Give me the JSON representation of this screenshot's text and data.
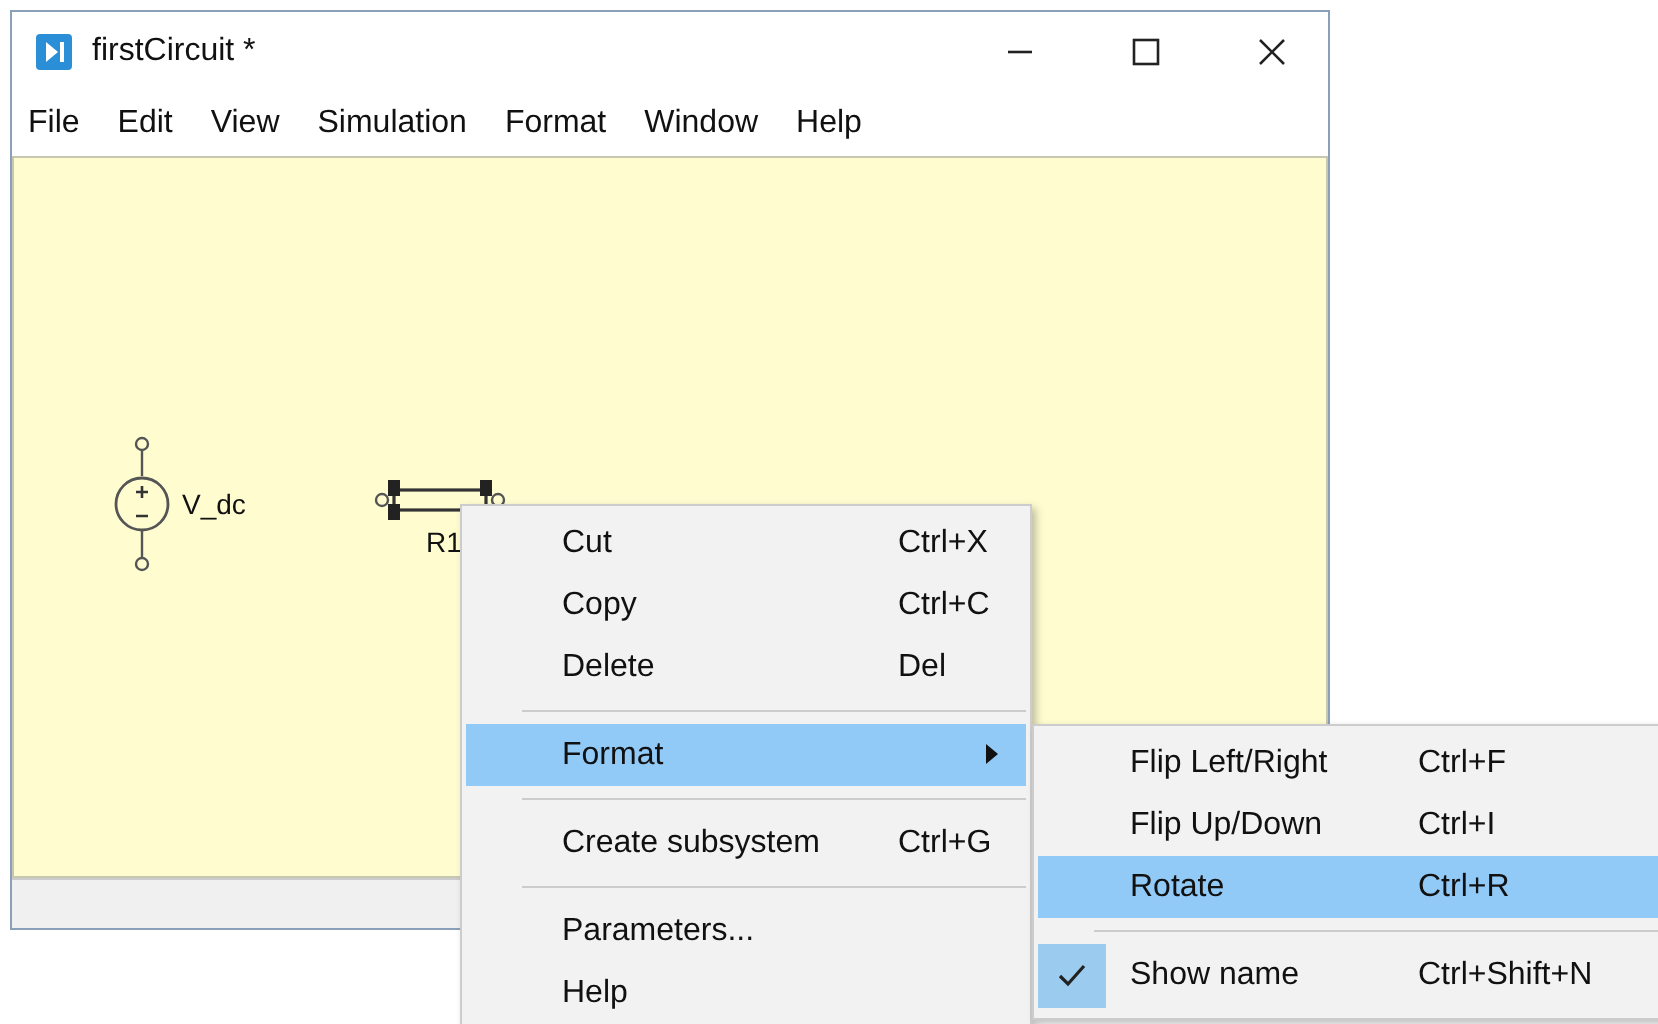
{
  "window": {
    "title": "firstCircuit *"
  },
  "menu_bar": [
    "File",
    "Edit",
    "View",
    "Simulation",
    "Format",
    "Window",
    "Help"
  ],
  "canvas": {
    "components": [
      {
        "kind": "voltage_source",
        "name": "V_dc",
        "selected": false
      },
      {
        "kind": "resistor",
        "name": "R1",
        "selected": true
      }
    ]
  },
  "context_menu": {
    "items": [
      {
        "kind": "item",
        "label": "Cut",
        "shortcut": "Ctrl+X",
        "selected": false,
        "submenu": false
      },
      {
        "kind": "item",
        "label": "Copy",
        "shortcut": "Ctrl+C",
        "selected": false,
        "submenu": false
      },
      {
        "kind": "item",
        "label": "Delete",
        "shortcut": "Del",
        "selected": false,
        "submenu": false
      },
      {
        "kind": "separator"
      },
      {
        "kind": "item",
        "label": "Format",
        "selected": true,
        "submenu": true
      },
      {
        "kind": "separator"
      },
      {
        "kind": "item",
        "label": "Create subsystem",
        "shortcut": "Ctrl+G",
        "selected": false,
        "submenu": false
      },
      {
        "kind": "separator"
      },
      {
        "kind": "item",
        "label": "Parameters...",
        "selected": false,
        "submenu": false
      },
      {
        "kind": "item",
        "label": "Help",
        "selected": false,
        "submenu": false
      }
    ]
  },
  "submenu": {
    "items": [
      {
        "kind": "item",
        "label": "Flip Left/Right",
        "shortcut": "Ctrl+F",
        "selected": false,
        "checked": false
      },
      {
        "kind": "item",
        "label": "Flip Up/Down",
        "shortcut": "Ctrl+I",
        "selected": false,
        "checked": false
      },
      {
        "kind": "item",
        "label": "Rotate",
        "shortcut": "Ctrl+R",
        "selected": true,
        "checked": false
      },
      {
        "kind": "separator"
      },
      {
        "kind": "item",
        "label": "Show name",
        "shortcut": "Ctrl+Shift+N",
        "selected": false,
        "checked": true
      }
    ]
  }
}
